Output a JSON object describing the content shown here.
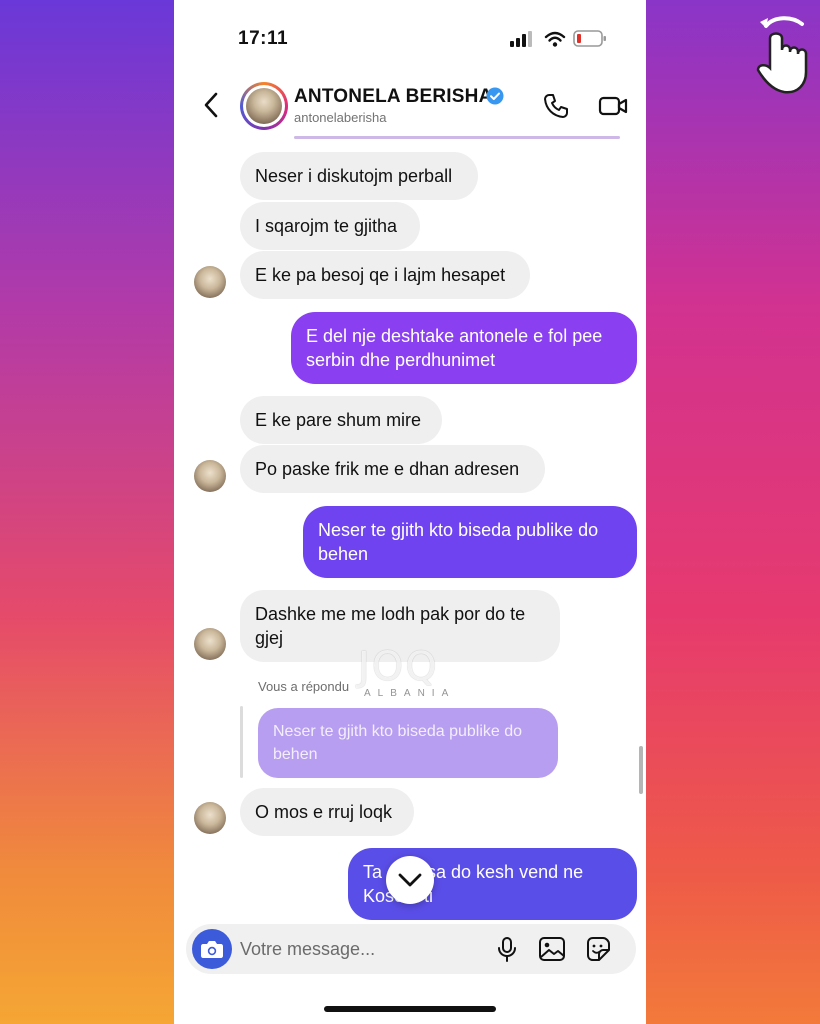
{
  "status": {
    "time": "17:11"
  },
  "header": {
    "name": "ANTONELA BERISHA",
    "handle": "antonelaberisha",
    "icons": [
      "back-arrow-icon",
      "verified-badge-icon",
      "phone-icon",
      "video-camera-icon"
    ]
  },
  "messages": [
    {
      "side": "in",
      "text": "Neser i diskutojm perball"
    },
    {
      "side": "in",
      "text": "I sqarojm te gjitha"
    },
    {
      "side": "in",
      "text": "E ke pa besoj qe i lajm hesapet"
    },
    {
      "side": "out",
      "text": "E del nje deshtake antonele e fol pee serbin dhe perdhunimet"
    },
    {
      "side": "in",
      "text": "E ke pare shum mire"
    },
    {
      "side": "in",
      "text": "Po paske frik me e dhan adresen"
    },
    {
      "side": "out",
      "text": "Neser te gjith kto biseda publike do behen"
    },
    {
      "side": "in",
      "text": "Dashke me me lodh pak por do te gjej"
    },
    {
      "side": "in",
      "text": "O mos e rruj loqk"
    },
    {
      "side": "out",
      "text": "Ta ... m sa do kesh vend ne Koso... ti"
    }
  ],
  "reply": {
    "label": "Vous a répondu",
    "quoted": "Neser te gjith kto biseda publike do behen"
  },
  "watermark": {
    "text": "JOQ",
    "sub": "ALBANIA"
  },
  "composer": {
    "placeholder": "Votre message..."
  },
  "colors": {
    "incoming_bubble": "#efefef",
    "outgoing_purple": "#8a3ff0",
    "outgoing_violet": "#6b44f0",
    "outgoing_blue": "#5a4ee8",
    "camera_button": "#3b5bdb",
    "verified": "#3897f0"
  }
}
